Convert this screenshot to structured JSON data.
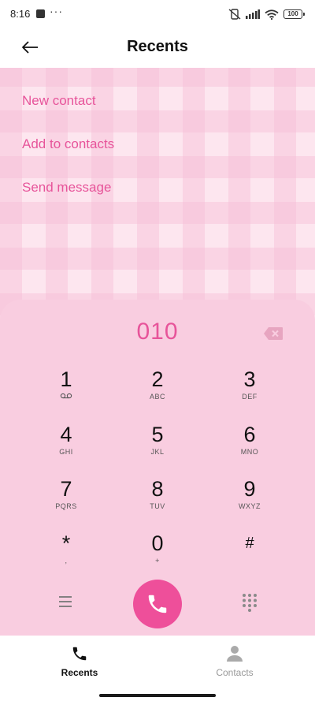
{
  "status_bar": {
    "time": "8:16",
    "dots": "···",
    "battery": "100",
    "icons": [
      "notification-square-icon",
      "vibrate-off-icon",
      "signal-icon",
      "wifi-icon",
      "battery-icon"
    ]
  },
  "header": {
    "title": "Recents",
    "back_icon": "arrow-left-icon"
  },
  "actions": [
    {
      "label": "New contact"
    },
    {
      "label": "Add to contacts"
    },
    {
      "label": "Send message"
    }
  ],
  "dialpad": {
    "number": "010",
    "keys": [
      {
        "digit": "1",
        "letters": ""
      },
      {
        "digit": "2",
        "letters": "ABC"
      },
      {
        "digit": "3",
        "letters": "DEF"
      },
      {
        "digit": "4",
        "letters": "GHI"
      },
      {
        "digit": "5",
        "letters": "JKL"
      },
      {
        "digit": "6",
        "letters": "MNO"
      },
      {
        "digit": "7",
        "letters": "PQRS"
      },
      {
        "digit": "8",
        "letters": "TUV"
      },
      {
        "digit": "9",
        "letters": "WXYZ"
      },
      {
        "digit": "*",
        "letters": ","
      },
      {
        "digit": "0",
        "letters": "+"
      },
      {
        "digit": "#",
        "letters": ""
      }
    ]
  },
  "bottom_nav": {
    "tabs": [
      {
        "label": "Recents",
        "icon": "phone-icon",
        "selected": true
      },
      {
        "label": "Contacts",
        "icon": "person-icon",
        "selected": false
      }
    ]
  },
  "colors": {
    "accent": "#e7549a",
    "call_button": "#ee4f9a",
    "dialpad_bg": "#f9cde0",
    "plaid_bg": "#fde6ef"
  }
}
